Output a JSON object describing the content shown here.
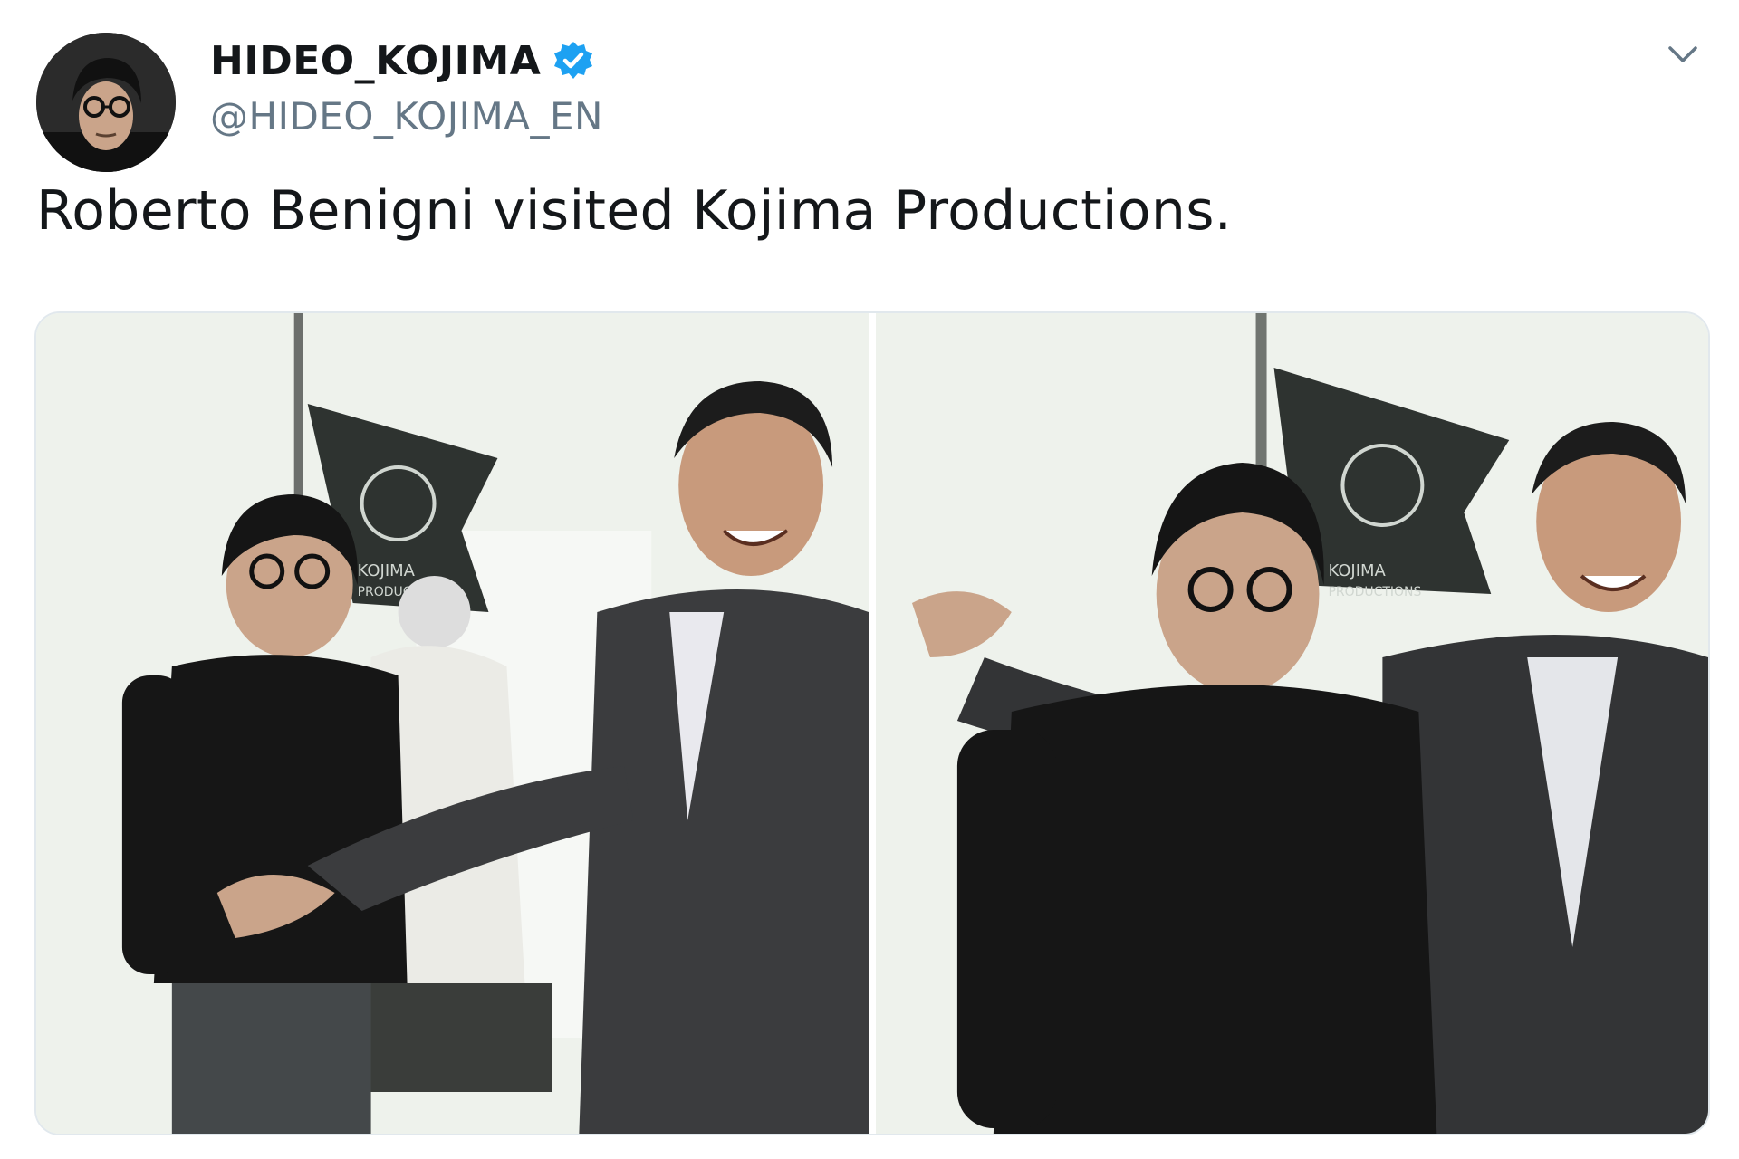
{
  "tweet": {
    "author": {
      "display_name": "HIDEO_KOJIMA",
      "handle": "@HIDEO_KOJIMA_EN",
      "verified": true,
      "avatar_icon": "avatar-photo"
    },
    "text": "Roberto Benigni visited Kojima Productions.",
    "menu_icon": "chevron-down-icon",
    "media": [
      {
        "name": "photo-1",
        "flag_text_line1": "KOJIMA",
        "flag_text_line2": "PRODUCTIONS"
      },
      {
        "name": "photo-2",
        "flag_text_line1": "KOJIMA",
        "flag_text_line2": "PRODUCTIONS"
      }
    ]
  },
  "colors": {
    "text": "#14171a",
    "secondary": "#657786",
    "verified": "#1da1f2",
    "border": "#e1e8ed"
  }
}
